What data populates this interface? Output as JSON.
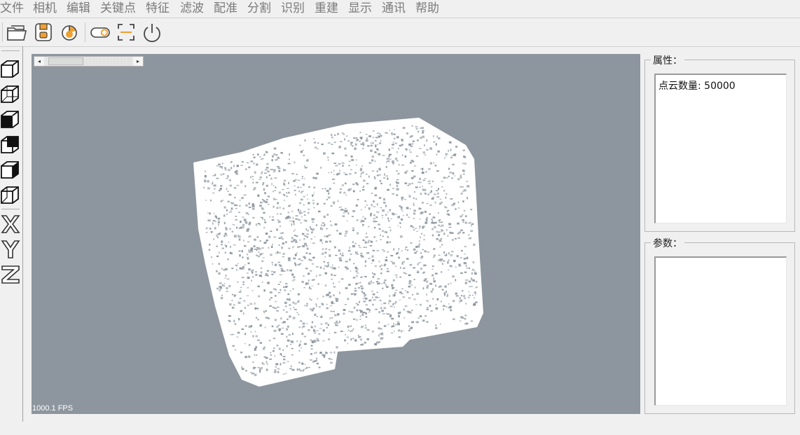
{
  "menu": {
    "items": [
      {
        "id": "file",
        "label": "文件"
      },
      {
        "id": "camera",
        "label": "相机"
      },
      {
        "id": "edit",
        "label": "编辑"
      },
      {
        "id": "keypoints",
        "label": "关键点"
      },
      {
        "id": "features",
        "label": "特征"
      },
      {
        "id": "filter",
        "label": "滤波"
      },
      {
        "id": "registration",
        "label": "配准"
      },
      {
        "id": "segmentation",
        "label": "分割"
      },
      {
        "id": "recognition",
        "label": "识别"
      },
      {
        "id": "reconstruction",
        "label": "重建"
      },
      {
        "id": "display",
        "label": "显示"
      },
      {
        "id": "communication",
        "label": "通讯"
      },
      {
        "id": "help",
        "label": "帮助"
      }
    ]
  },
  "toolbar": {
    "buttons": [
      {
        "id": "open",
        "icon": "open-folder-icon"
      },
      {
        "id": "save",
        "icon": "save-disk-icon"
      },
      {
        "id": "camera-power",
        "icon": "camera-power-icon"
      },
      {
        "id": "toggle",
        "icon": "toggle-switch-icon"
      },
      {
        "id": "fit-view",
        "icon": "fit-frame-icon"
      },
      {
        "id": "power",
        "icon": "power-icon"
      }
    ]
  },
  "view_toolbar": {
    "buttons": [
      {
        "id": "view-iso",
        "icon": "cube-view-icon"
      },
      {
        "id": "view-front",
        "icon": "cube-front-icon"
      },
      {
        "id": "view-back",
        "icon": "cube-back-icon"
      },
      {
        "id": "view-top",
        "icon": "cube-top-icon"
      },
      {
        "id": "view-left",
        "icon": "cube-left-icon"
      },
      {
        "id": "view-right",
        "icon": "cube-right-icon"
      },
      {
        "id": "axis-x",
        "icon": "axis-x-icon"
      },
      {
        "id": "axis-y",
        "icon": "axis-y-icon"
      },
      {
        "id": "axis-z",
        "icon": "axis-z-icon"
      }
    ]
  },
  "viewport": {
    "fps_text": "1000.1 FPS",
    "background_color": "#8d969e",
    "point_color": "#ffffff"
  },
  "properties_panel": {
    "title": "属性：",
    "point_count_label": "点云数量: 50000"
  },
  "parameters_panel": {
    "title": "参数："
  },
  "colors": {
    "window_bg": "#f0f0f0",
    "menu_text": "#7b7b7b",
    "accent_orange": "#f0a030"
  }
}
